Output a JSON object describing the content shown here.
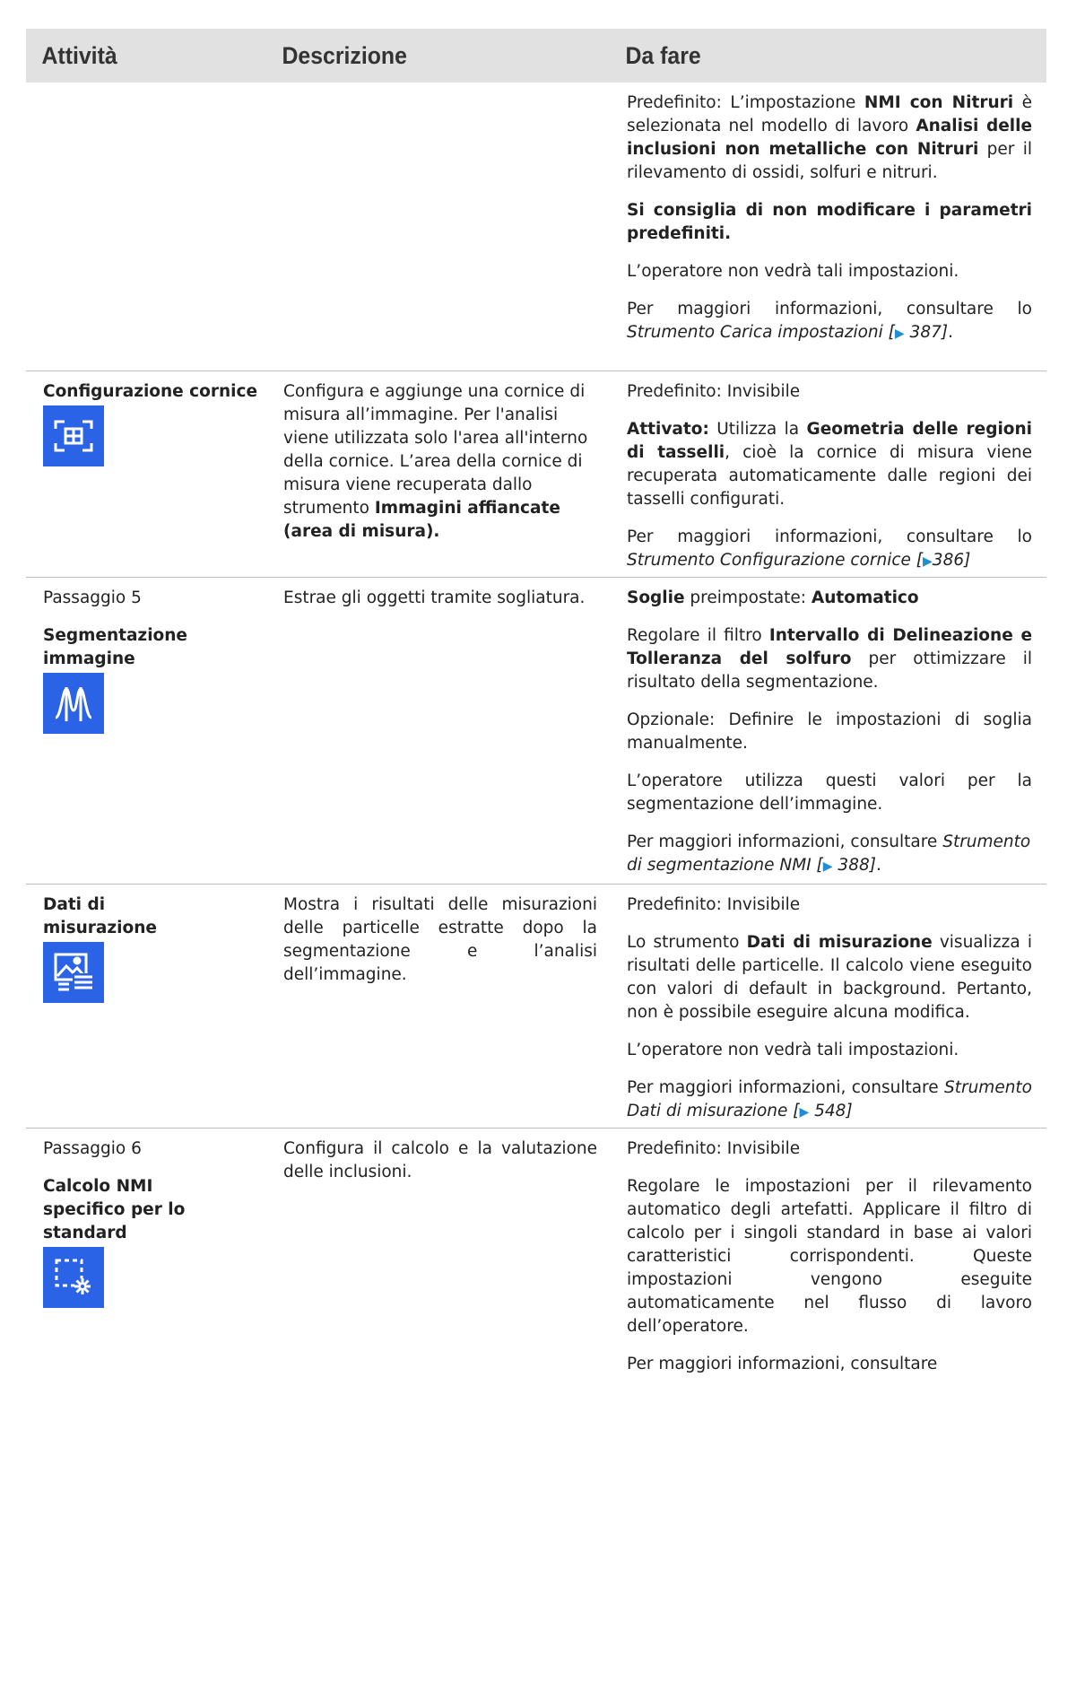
{
  "header": {
    "col1": "Attività",
    "col2": "Descrizione",
    "col3": "Da fare"
  },
  "row0": {
    "p1_a": "Predefinito: L’impostazione ",
    "p1_b": "NMI con Nitruri",
    "p1_c": " è selezionata nel modello di lavoro ",
    "p1_d": "Analisi delle inclusioni non metalliche con Nitruri",
    "p1_e": " per il rilevamento di ossidi, solfuri e nitruri.",
    "p2": "Si consiglia di non modificare i parametri predefiniti.",
    "p3": "L’operatore non vedrà tali impostazioni.",
    "p4_a": "Per maggiori informazioni, consultare lo ",
    "p4_link": "Strumento Carica impostazioni [",
    "p4_ref": " 387]",
    "p4_end": "."
  },
  "row1": {
    "activity": "Configurazione cornice",
    "icon": "frame-config-icon",
    "desc_a": " Configura e aggiunge una cornice di misura all’immagine. Per l'analisi viene utilizzata solo l'area all'interno della cornice. L’area della cornice di misura viene recuperata dallo strumento ",
    "desc_b": "Immagini affiancate (area di misura).",
    "p1": "Predefinito: Invisibile",
    "p2_a": "Attivato:",
    "p2_b": " Utilizza la ",
    "p2_c": "Geometria delle regioni di tasselli",
    "p2_d": ", cioè la cornice di misura viene recuperata automaticamente dalle regioni dei tasselli configurati.",
    "p3_a": "Per maggiori informazioni, consultare lo ",
    "p3_link": "Strumento Configurazione cornice [",
    "p3_ref": "386]"
  },
  "row2": {
    "step": "Passaggio 5",
    "activity": "Segmentazione immagine",
    "icon": "segmentation-icon",
    "desc": "Estrae gli oggetti tramite sogliatura.",
    "p1_a": "Soglie",
    "p1_b": " preimpostate: ",
    "p1_c": "Automatico",
    "p2_a": "Regolare il filtro ",
    "p2_b": "Intervallo di Delineazione e Tolleranza del solfuro",
    "p2_c": " per ottimizzare il risultato della segmentazione.",
    "p3": "Opzionale: Definire le impostazioni di soglia manualmente.",
    "p4": "L’operatore utilizza questi valori per la segmentazione dell’immagine.",
    "p5_a": "Per maggiori informazioni, consultare ",
    "p5_link": "Strumento di segmentazione NMI [",
    "p5_ref": "   388]",
    "p5_end": "."
  },
  "row3": {
    "activity": "Dati di misurazione",
    "icon": "measurement-data-icon",
    "desc": "Mostra i risultati delle misurazioni delle particelle estratte dopo la segmentazione e l’analisi dell’immagine.",
    "p1": "Predefinito: Invisibile",
    "p2_a": "Lo strumento ",
    "p2_b": "Dati di misurazione",
    "p2_c": " visualizza i risultati delle particelle. Il calcolo viene eseguito con valori di default in background. Pertanto, non è possibile eseguire alcuna modifica.",
    "p3": "L’operatore non vedrà tali impostazioni.",
    "p4_a": "Per maggiori informazioni, consultare ",
    "p4_link": "Strumento Dati di misurazione [",
    "p4_ref": "   548]"
  },
  "row4": {
    "step": "Passaggio 6",
    "activity": "Calcolo NMI specifico per lo standard",
    "icon": "nmi-calculation-icon",
    "desc": "Configura il calcolo e la valutazione delle inclusioni.",
    "p1": "Predefinito: Invisibile",
    "p2": "Regolare le impostazioni per il rilevamento automatico degli artefatti. Applicare il filtro di calcolo per i singoli standard in base ai valori caratteristici corrispondenti. Queste impostazioni vengono eseguite automaticamente nel flusso di lavoro dell’operatore.",
    "p3": "Per maggiori informazioni, consultare"
  },
  "colors": {
    "header_bg": "#e1e1e1",
    "icon_bg": "#2b63e6",
    "link_arrow": "#1e8ed6"
  }
}
